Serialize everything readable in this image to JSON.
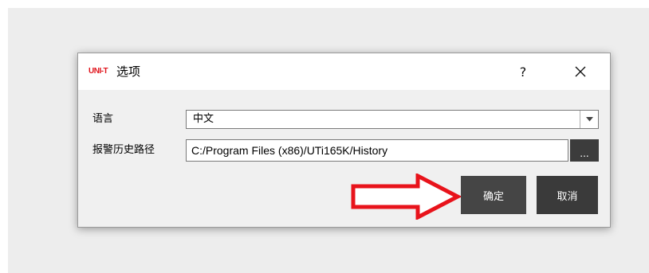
{
  "dialog": {
    "logo_text": "UNI-T",
    "title": "选项",
    "help_label": "?",
    "close_icon": "close-icon"
  },
  "form": {
    "language_label": "语言",
    "language_value": "中文",
    "history_path_label": "报警历史路径",
    "history_path_value": "C:/Program Files (x86)/UTi165K/History",
    "browse_label": "..."
  },
  "buttons": {
    "ok_label": "确定",
    "cancel_label": "取消"
  },
  "annotation": {
    "arrow_color": "#e8131b",
    "arrow_icon": "right-arrow-icon"
  }
}
